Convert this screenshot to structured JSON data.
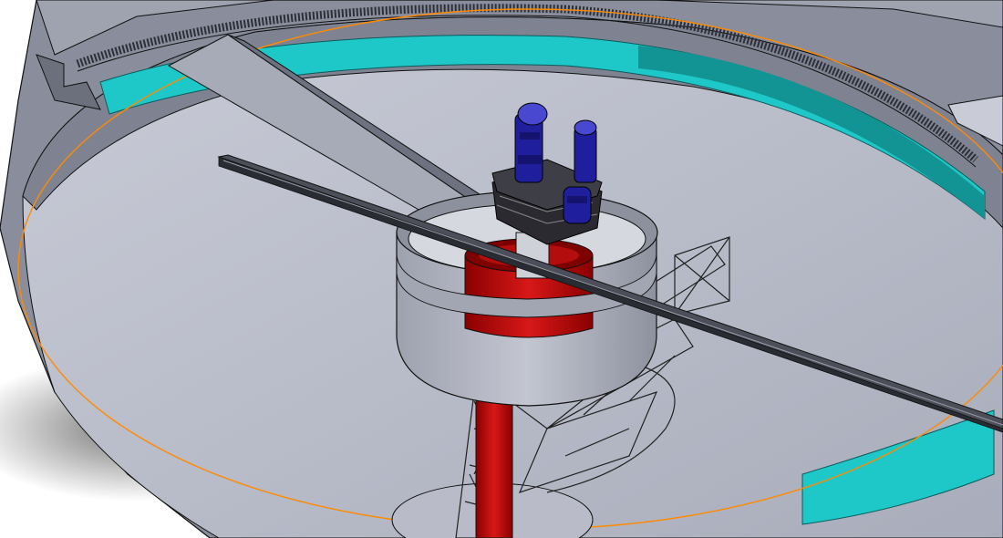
{
  "model": {
    "type": "cad-3d-section-view",
    "components": [
      "circular-tank",
      "toothed-rim-gear",
      "teal-collar",
      "center-pier-column",
      "lattice-truss-support",
      "feed-well-drum",
      "drive-head",
      "drive-motors",
      "bridge-beam",
      "rake-arm",
      "orange-reference-circle"
    ]
  },
  "colors": {
    "background": "#ffffff",
    "tank_wall": "#8a8e9c",
    "tank_wall_dark": "#5f6270",
    "tank_floor": "#a9adbb",
    "tank_floor_light": "#c9ccd7",
    "teal_collar": "#1ec8c8",
    "teal_dark": "#129494",
    "orange_circle": "#ff8a00",
    "column_red": "#c41414",
    "column_red_dark": "#7e0000",
    "motor_blue": "#1f1f9e",
    "motor_blue_light": "#4848d0",
    "drive_dark": "#2a2a30",
    "drum_grey": "#b4b7c3",
    "drum_dark": "#868997",
    "outline": "#111111"
  }
}
